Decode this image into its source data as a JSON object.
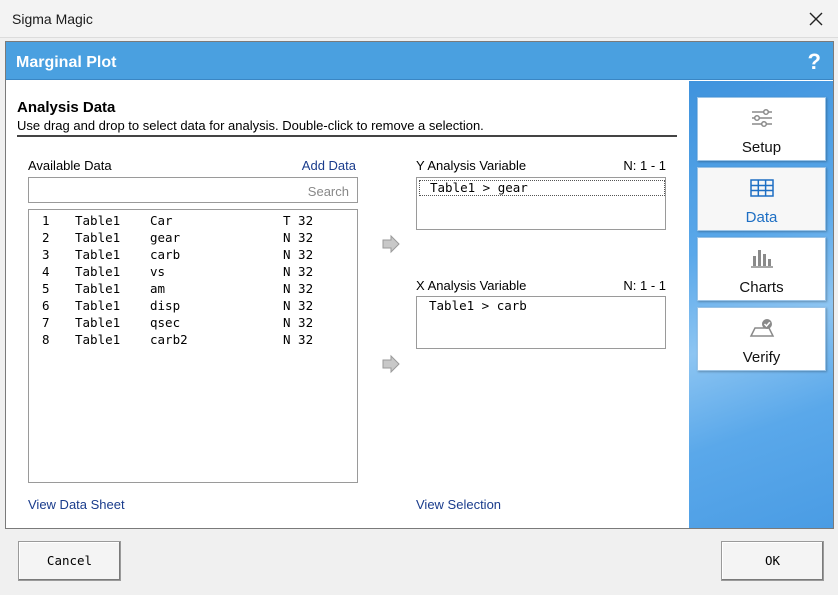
{
  "window": {
    "title": "Sigma Magic"
  },
  "header": {
    "title": "Marginal Plot",
    "help": "?"
  },
  "section": {
    "title": "Analysis Data",
    "description": "Use drag and drop to select data for analysis. Double-click to remove a selection."
  },
  "available": {
    "label": "Available Data",
    "add_link": "Add Data",
    "search_placeholder": "Search",
    "rows": [
      {
        "num": "1",
        "table": "Table1",
        "column": "Car",
        "type": "T 32"
      },
      {
        "num": "2",
        "table": "Table1",
        "column": "gear",
        "type": "N 32"
      },
      {
        "num": "3",
        "table": "Table1",
        "column": "carb",
        "type": "N 32"
      },
      {
        "num": "4",
        "table": "Table1",
        "column": "vs",
        "type": "N 32"
      },
      {
        "num": "5",
        "table": "Table1",
        "column": "am",
        "type": "N 32"
      },
      {
        "num": "6",
        "table": "Table1",
        "column": "disp",
        "type": "N 32"
      },
      {
        "num": "7",
        "table": "Table1",
        "column": "qsec",
        "type": "N 32"
      },
      {
        "num": "8",
        "table": "Table1",
        "column": "carb2",
        "type": "N 32"
      }
    ],
    "view_link": "View Data Sheet"
  },
  "y_variable": {
    "label": "Y Analysis Variable",
    "count": "N: 1 - 1",
    "value": "Table1 > gear"
  },
  "x_variable": {
    "label": "X Analysis Variable",
    "count": "N: 1 - 1",
    "value": "Table1 > carb"
  },
  "view_selection": "View Selection",
  "nav": [
    {
      "label": "Setup",
      "icon": "sliders-icon",
      "active": false
    },
    {
      "label": "Data",
      "icon": "table-icon",
      "active": true
    },
    {
      "label": "Charts",
      "icon": "bar-chart-icon",
      "active": false
    },
    {
      "label": "Verify",
      "icon": "verify-icon",
      "active": false
    }
  ],
  "footer": {
    "cancel": "Cancel",
    "ok": "OK"
  },
  "colors": {
    "header": "#4aa0e0",
    "accent": "#1e6fc4",
    "link": "#1a3c8c"
  }
}
